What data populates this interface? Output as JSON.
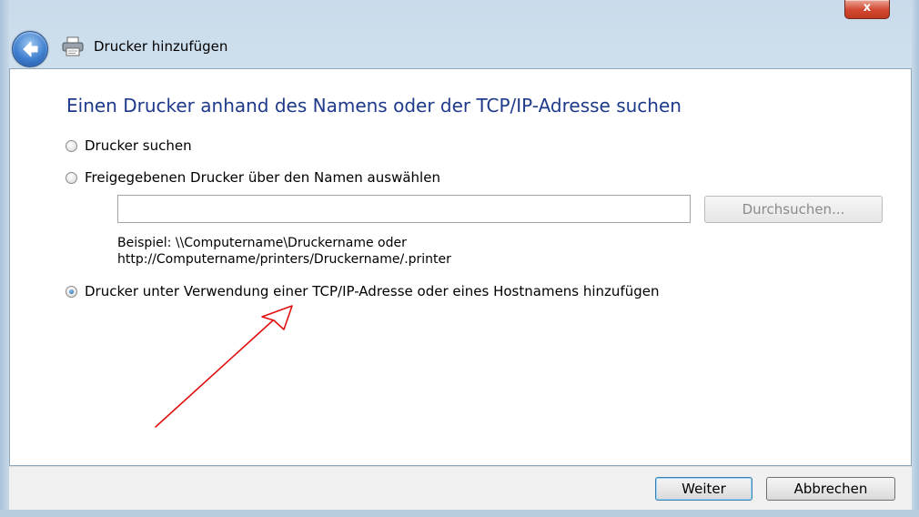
{
  "window": {
    "title": "Drucker hinzufügen",
    "close_label": "x"
  },
  "page": {
    "heading": "Einen Drucker anhand des Namens oder der TCP/IP-Adresse suchen"
  },
  "options": [
    {
      "label": "Drucker suchen",
      "checked": false
    },
    {
      "label": "Freigegebenen Drucker über den Namen auswählen",
      "checked": false
    },
    {
      "label": "Drucker unter Verwendung einer TCP/IP-Adresse oder eines Hostnamens hinzufügen",
      "checked": true
    }
  ],
  "share_input": {
    "value": "",
    "browse_label": "Durchsuchen..."
  },
  "example": {
    "line1": "Beispiel: \\\\Computername\\Druckername oder",
    "line2": "http://Computername/printers/Druckername/.printer"
  },
  "footer": {
    "next_label": "Weiter",
    "cancel_label": "Abbrechen"
  },
  "annotation": {
    "arrow_color": "#e01010"
  },
  "colors": {
    "heading": "#1e3a8a",
    "close_button": "#d2472f"
  }
}
